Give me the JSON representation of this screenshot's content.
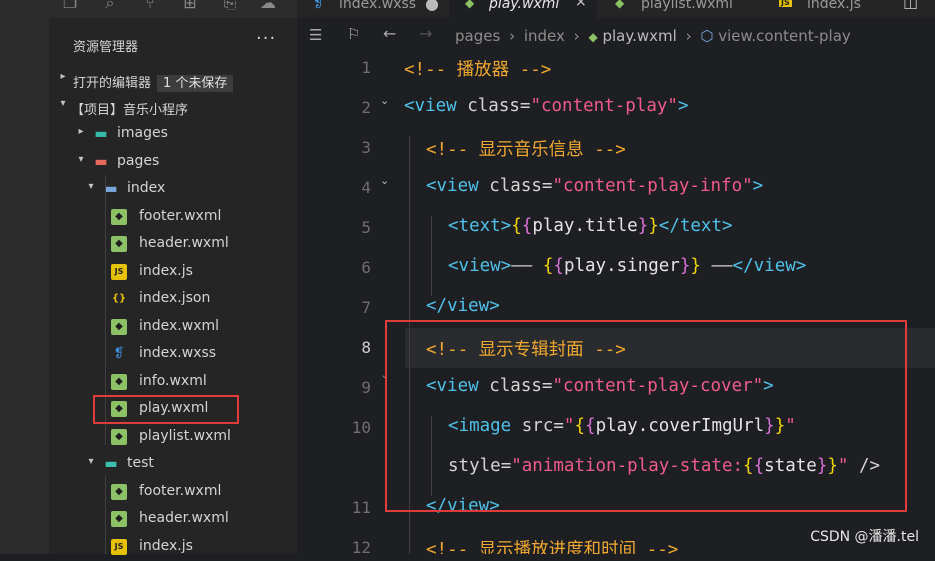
{
  "activity_icons": [
    "files-icon",
    "search-icon",
    "source-control-icon",
    "extensions-icon",
    "debug-icon",
    "remote-icon"
  ],
  "sidebar": {
    "title": "资源管理器",
    "more": "···",
    "open_editors": {
      "label": "打开的编辑器",
      "badge": "1 个未保存"
    },
    "project": "【项目】音乐小程序",
    "tree": [
      {
        "label": "images",
        "type": "folder-img",
        "depth": 1,
        "chev": "▸"
      },
      {
        "label": "pages",
        "type": "folder-pages",
        "depth": 1,
        "chev": "▾"
      },
      {
        "label": "index",
        "type": "folder",
        "depth": 2,
        "chev": "▾"
      },
      {
        "label": "footer.wxml",
        "type": "wxml",
        "depth": 3
      },
      {
        "label": "header.wxml",
        "type": "wxml",
        "depth": 3
      },
      {
        "label": "index.js",
        "type": "js",
        "depth": 3
      },
      {
        "label": "index.json",
        "type": "json",
        "depth": 3
      },
      {
        "label": "index.wxml",
        "type": "wxml",
        "depth": 3
      },
      {
        "label": "index.wxss",
        "type": "css",
        "depth": 3
      },
      {
        "label": "info.wxml",
        "type": "wxml",
        "depth": 3
      },
      {
        "label": "play.wxml",
        "type": "wxml",
        "depth": 3
      },
      {
        "label": "playlist.wxml",
        "type": "wxml",
        "depth": 3
      },
      {
        "label": "test",
        "type": "folder-test",
        "depth": 2,
        "chev": "▾"
      },
      {
        "label": "footer.wxml",
        "type": "wxml",
        "depth": 3
      },
      {
        "label": "header.wxml",
        "type": "wxml",
        "depth": 3
      },
      {
        "label": "index.js",
        "type": "js",
        "depth": 3
      }
    ]
  },
  "tabs": [
    {
      "label": "index.wxss",
      "icon": "css",
      "dirty": true
    },
    {
      "label": "play.wxml",
      "icon": "wxml",
      "active": true,
      "close": "×"
    },
    {
      "label": "playlist.wxml",
      "icon": "wxml"
    },
    {
      "label": "index.js",
      "icon": "js"
    }
  ],
  "breadcrumb": [
    "pages",
    "index",
    "play.wxml",
    "view.content-play"
  ],
  "editor": {
    "line_numbers": [
      "1",
      "2",
      "3",
      "4",
      "5",
      "6",
      "7",
      "8",
      "9",
      "10",
      "11",
      "12"
    ],
    "current_line": "8",
    "lines": [
      "<!-- 播放器 -->",
      "<view class=\"content-play\">",
      "<!-- 显示音乐信息 -->",
      "<view class=\"content-play-info\">",
      "<text>{{play.title}}</text>",
      "<view>—— {{play.singer}} ——</view>",
      "</view>",
      "<!-- 显示专辑封面 -->",
      "<view class=\"content-play-cover\">",
      "<image src=\"{{play.coverImgUrl}}\"",
      "style=\"animation-play-state:{{state}}\" />",
      "</view>",
      "<!-- 显示播放进度和时间 -->"
    ]
  },
  "watermark": "CSDN @潘潘.tel",
  "colors": {
    "highlight_box": "#e03c3c",
    "comment": "#f0a830",
    "tag": "#4fc1e9",
    "string": "#ef5b8a"
  }
}
